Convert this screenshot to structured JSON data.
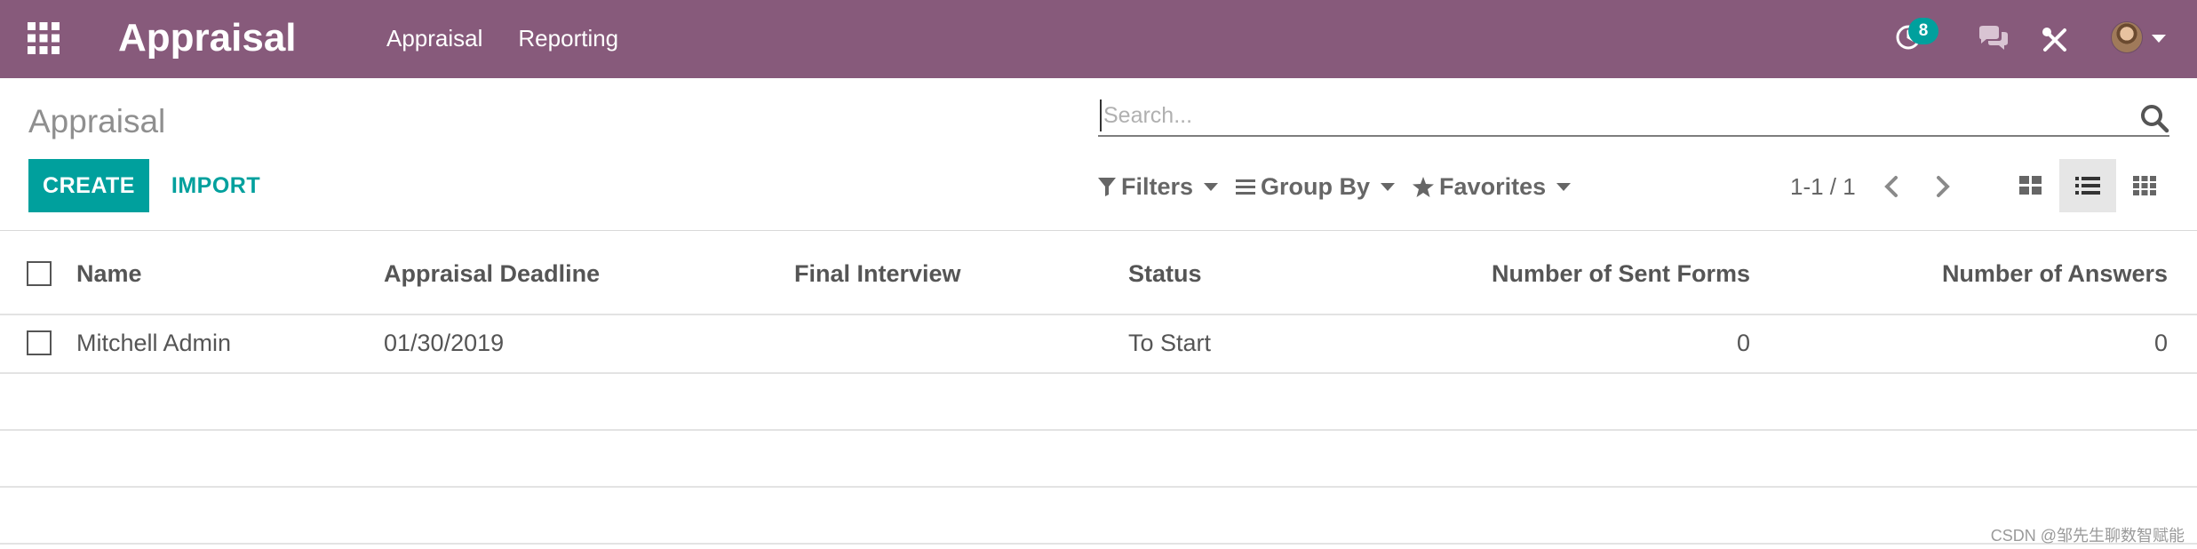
{
  "navbar": {
    "app_name": "Appraisal",
    "menu": [
      "Appraisal",
      "Reporting"
    ],
    "activity_count": "8",
    "icons": [
      "apps-icon",
      "activity-icon",
      "chat-icon",
      "debug-icon",
      "avatar",
      "user-menu-caret"
    ]
  },
  "control_panel": {
    "breadcrumb": "Appraisal",
    "create_label": "CREATE",
    "import_label": "IMPORT",
    "search_placeholder": "Search...",
    "filters_label": "Filters",
    "group_by_label": "Group By",
    "favorites_label": "Favorites",
    "pager": "1-1 / 1",
    "views": [
      "kanban",
      "list",
      "grid"
    ],
    "active_view": "list"
  },
  "table": {
    "columns": [
      "Name",
      "Appraisal Deadline",
      "Final Interview",
      "Status",
      "Number of Sent Forms",
      "Number of Answers"
    ],
    "rows": [
      {
        "name": "Mitchell Admin",
        "deadline": "01/30/2019",
        "final_interview": "",
        "status": "To Start",
        "sent_forms": "0",
        "answers": "0"
      }
    ]
  },
  "watermark": "CSDN @邹先生聊数智赋能",
  "colors": {
    "navbar": "#875a7b",
    "primary": "#00a09d"
  }
}
